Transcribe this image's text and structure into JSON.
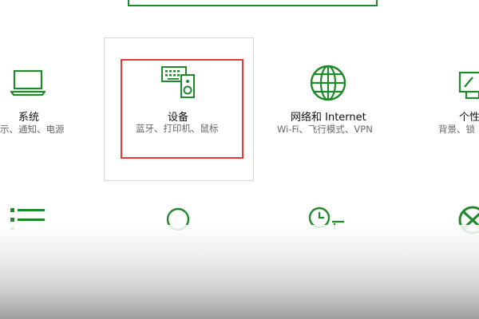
{
  "tiles": [
    {
      "id": "system",
      "title": "系统",
      "subtitle": "示、通知、电源",
      "icon": "laptop-icon"
    },
    {
      "id": "devices",
      "title": "设备",
      "subtitle": "蓝牙、打印机、鼠标",
      "icon": "devices-icon"
    },
    {
      "id": "network",
      "title": "网络和 Internet",
      "subtitle": "Wi-Fi、飞行模式、VPN",
      "icon": "globe-icon"
    },
    {
      "id": "personalization",
      "title": "个性",
      "subtitle": "背景、锁",
      "icon": "personalization-icon"
    }
  ],
  "colors": {
    "accent": "#1f8a2a",
    "highlight": "#e53935",
    "tile_border": "#d9d9d9"
  }
}
